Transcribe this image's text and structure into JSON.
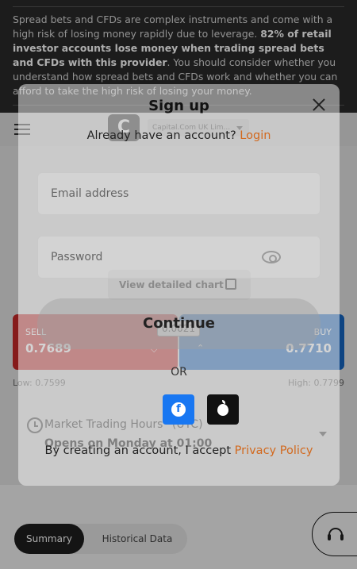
{
  "risk": {
    "text_1": "Spread bets and CFDs are complex instruments and come with a high risk of losing money rapidly due to leverage. ",
    "bold": "82% of retail investor accounts lose money when trading spread bets and CFDs with this provider",
    "text_2": ". You should consider whether you understand how spread bets and CFDs work and whether you can afford to take the high risk of losing your money."
  },
  "header": {
    "logo_letter": "C",
    "entity": "Capital.Com UK Lim..."
  },
  "chart": {
    "detail_button": "View detailed chart"
  },
  "trade": {
    "sell_label": "SELL",
    "sell_value": "0.7689",
    "buy_label": "BUY",
    "buy_value": "0.7710",
    "spread": "0.0021",
    "low": "Low: 0.7599",
    "high": "High: 0.7799"
  },
  "market": {
    "label": "Market Trading Hours* (UTC)",
    "status": "Opens on Monday at 01:00"
  },
  "tabs": {
    "summary": "Summary",
    "historical": "Historical Data"
  },
  "modal": {
    "title": "Sign up",
    "account_prompt": "Already have an account?",
    "login_link": "Login",
    "email_placeholder": "Email address",
    "password_placeholder": "Password",
    "continue_label": "Continue",
    "or_label": "OR",
    "facebook_letter": "f",
    "terms_prefix": "By creating an account, I accept",
    "privacy_link": "Privacy Policy"
  },
  "colors": {
    "sell": "#c62828",
    "buy": "#1565c0",
    "link": "#d2691e",
    "facebook": "#1877f2"
  }
}
